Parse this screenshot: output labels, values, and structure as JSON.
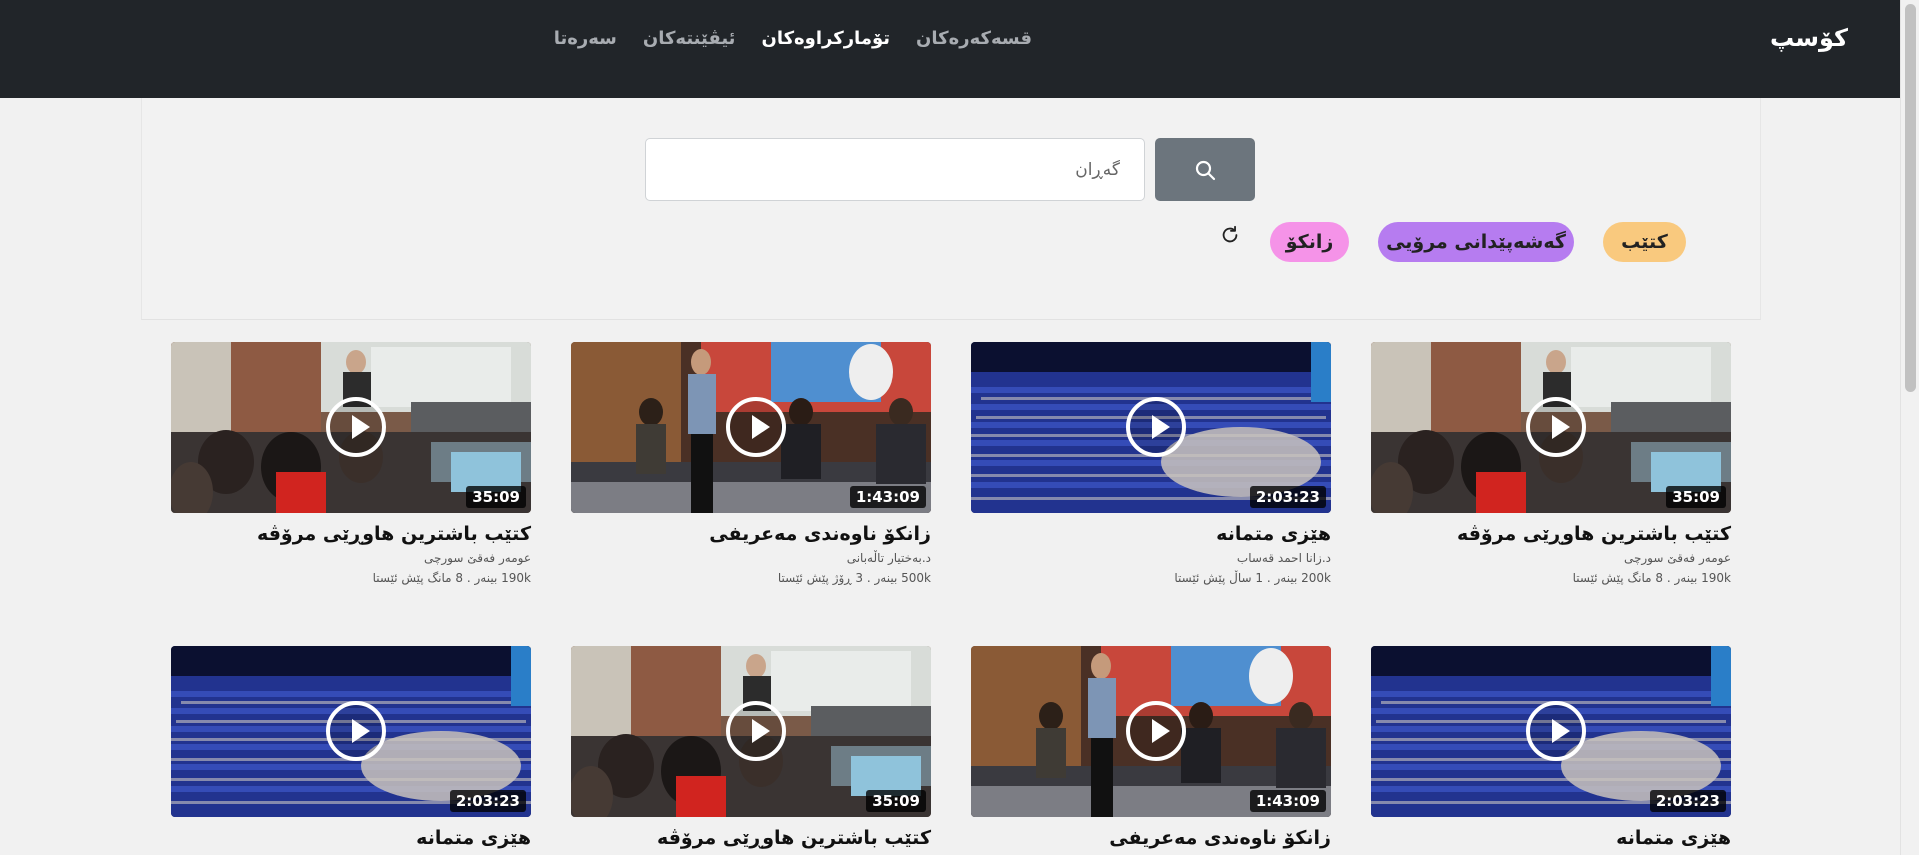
{
  "brand": "کۆسپ",
  "nav": [
    {
      "label": "سەرەتا",
      "active": false
    },
    {
      "label": "ئیڤێنتەکان",
      "active": false
    },
    {
      "label": "تۆمارکراوەکان",
      "active": true
    },
    {
      "label": "قسەکەرەکان",
      "active": false
    }
  ],
  "search": {
    "placeholder": "گەڕان",
    "value": ""
  },
  "tags": [
    {
      "label": "کتێب",
      "color": "#f9c97e"
    },
    {
      "label": "گەشەپێدانی مرۆیی",
      "color": "#b67cf0"
    },
    {
      "label": "زانکۆ",
      "color": "#f593e8"
    }
  ],
  "videos": [
    {
      "title": "کتێب باشترین هاوڕێی مرۆڤە",
      "author": "عومەر فەقێ سورچی",
      "meta": "190k بینەر . 8 مانگ پێش ئێستا",
      "duration": "35:09",
      "scene": "classroom"
    },
    {
      "title": "هێزی متمانە",
      "author": "د.زانا احمد قەساب",
      "meta": "200k بینەر . 1 ساڵ پێش ئێستا",
      "duration": "2:03:23",
      "scene": "auditorium"
    },
    {
      "title": "زانکۆ ناوەندی مەعریفی",
      "author": "د.بەختیار تاڵەبانی",
      "meta": "500k بینەر . 3 ڕۆژ پێش ئێستا",
      "duration": "1:43:09",
      "scene": "stage"
    },
    {
      "title": "کتێب باشترین هاوڕێی مرۆڤە",
      "author": "عومەر فەقێ سورچی",
      "meta": "190k بینەر . 8 مانگ پێش ئێستا",
      "duration": "35:09",
      "scene": "classroom"
    },
    {
      "title": "هێزی متمانە",
      "author": "",
      "meta": "",
      "duration": "2:03:23",
      "scene": "auditorium"
    },
    {
      "title": "زانکۆ ناوەندی مەعریفی",
      "author": "",
      "meta": "",
      "duration": "1:43:09",
      "scene": "stage"
    },
    {
      "title": "کتێب باشترین هاوڕێی مرۆڤە",
      "author": "",
      "meta": "",
      "duration": "35:09",
      "scene": "classroom"
    },
    {
      "title": "هێزی متمانە",
      "author": "",
      "meta": "",
      "duration": "2:03:23",
      "scene": "auditorium"
    }
  ]
}
